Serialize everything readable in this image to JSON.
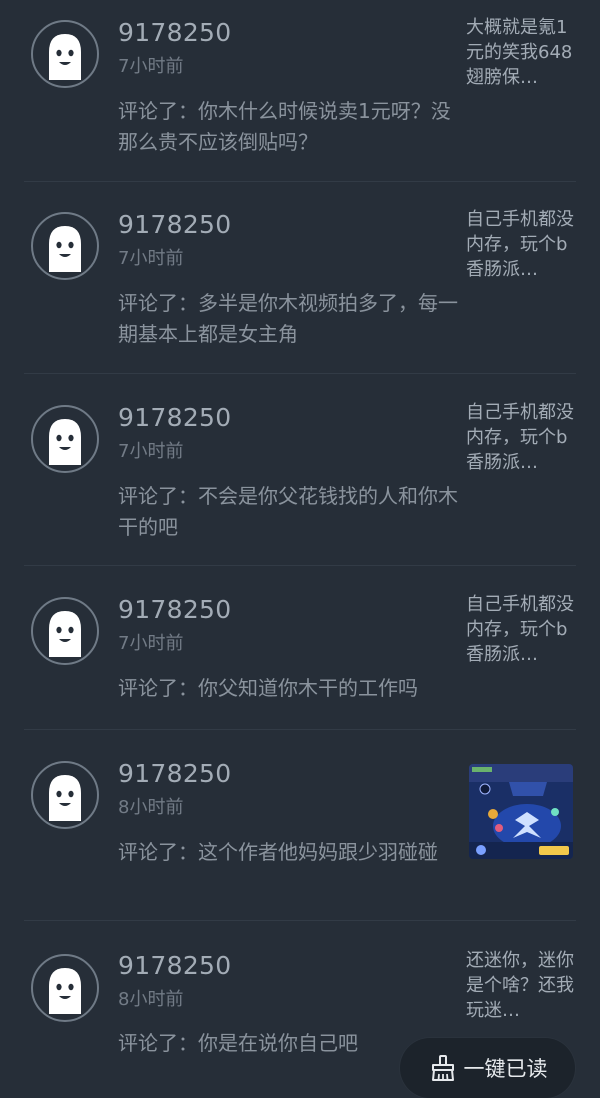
{
  "notifications": [
    {
      "username": "9178250",
      "time": "7小时前",
      "comment_prefix": "评论了：",
      "comment_text": "你木什么时候说卖1元呀？没那么贵不应该倒贴吗？",
      "ref_text": "大概就是氪1元的笑我648翅膀保…"
    },
    {
      "username": "9178250",
      "time": "7小时前",
      "comment_prefix": "评论了：",
      "comment_text": "多半是你木视频拍多了，每一期基本上都是女主角",
      "ref_text": "自己手机都没内存，玩个b香肠派…"
    },
    {
      "username": "9178250",
      "time": "7小时前",
      "comment_prefix": "评论了：",
      "comment_text": "不会是你父花钱找的人和你木干的吧",
      "ref_text": "自己手机都没内存，玩个b香肠派…"
    },
    {
      "username": "9178250",
      "time": "7小时前",
      "comment_prefix": "评论了：",
      "comment_text": "你父知道你木干的工作吗",
      "ref_text": "自己手机都没内存，玩个b香肠派…"
    },
    {
      "username": "9178250",
      "time": "8小时前",
      "comment_prefix": "评论了：",
      "comment_text": "这个作者他妈妈跟少羽碰碰",
      "ref_thumbnail": "game-screenshot-thumbnail"
    },
    {
      "username": "9178250",
      "time": "8小时前",
      "comment_prefix": "评论了：",
      "comment_text": "你是在说你自己吧",
      "ref_text": "还迷你，迷你是个啥？还我玩迷…"
    }
  ],
  "fab": {
    "label": "一键已读",
    "icon": "broom-icon"
  },
  "colors": {
    "background": "#262e38",
    "username": "#a3acb6",
    "muted": "#727b86",
    "fab_bg": "#1c232b"
  }
}
